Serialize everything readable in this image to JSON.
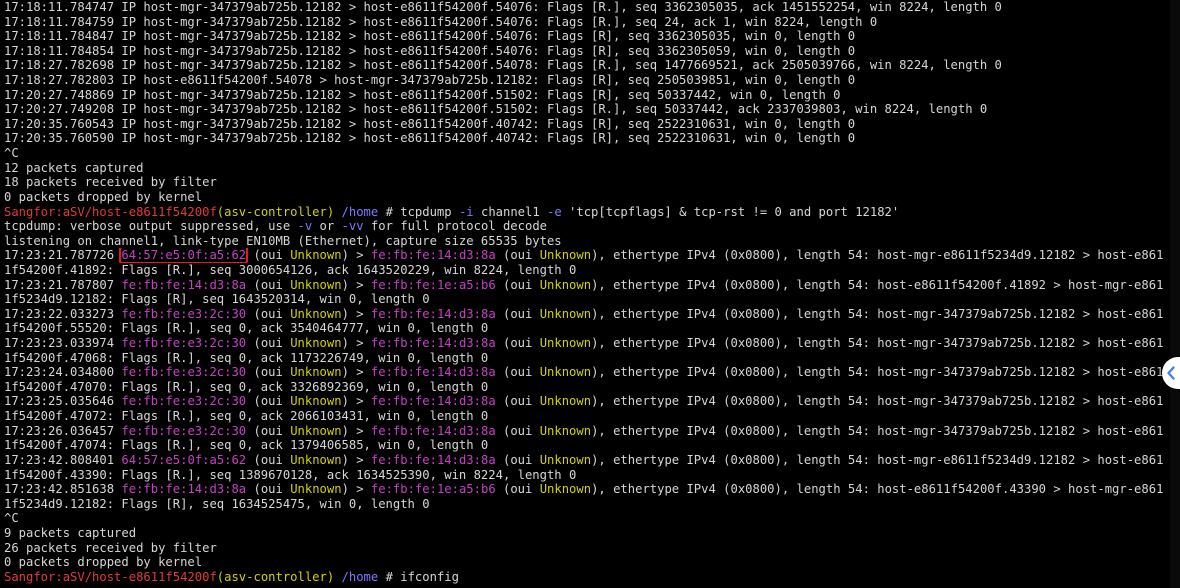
{
  "terminal": {
    "lines": [
      [
        {
          "t": "17:18:11.784747 IP host-mgr-347379ab725b.12182 > host-e8611f54200f.54076: Flags [R.], seq 3362305035, ack 1451552254, win 8224, length 0"
        }
      ],
      [
        {
          "t": "17:18:11.784759 IP host-mgr-347379ab725b.12182 > host-e8611f54200f.54076: Flags [R.], seq 24, ack 1, win 8224, length 0"
        }
      ],
      [
        {
          "t": "17:18:11.784847 IP host-mgr-347379ab725b.12182 > host-e8611f54200f.54076: Flags [R], seq 3362305035, win 0, length 0"
        }
      ],
      [
        {
          "t": "17:18:11.784854 IP host-mgr-347379ab725b.12182 > host-e8611f54200f.54076: Flags [R], seq 3362305059, win 0, length 0"
        }
      ],
      [
        {
          "t": "17:18:27.782698 IP host-mgr-347379ab725b.12182 > host-e8611f54200f.54078: Flags [R.], seq 1477669521, ack 2505039766, win 8224, length 0"
        }
      ],
      [
        {
          "t": "17:18:27.782803 IP host-e8611f54200f.54078 > host-mgr-347379ab725b.12182: Flags [R], seq 2505039851, win 0, length 0"
        }
      ],
      [
        {
          "t": "17:20:27.748869 IP host-mgr-347379ab725b.12182 > host-e8611f54200f.51502: Flags [R], seq 50337442, win 0, length 0"
        }
      ],
      [
        {
          "t": "17:20:27.749208 IP host-mgr-347379ab725b.12182 > host-e8611f54200f.51502: Flags [R.], seq 50337442, ack 2337039803, win 8224, length 0"
        }
      ],
      [
        {
          "t": "17:20:35.760543 IP host-mgr-347379ab725b.12182 > host-e8611f54200f.40742: Flags [R], seq 2522310631, win 0, length 0"
        }
      ],
      [
        {
          "t": "17:20:35.760590 IP host-mgr-347379ab725b.12182 > host-e8611f54200f.40742: Flags [R], seq 2522310631, win 0, length 0"
        }
      ],
      [
        {
          "t": "^C"
        }
      ],
      [
        {
          "t": "12 packets captured"
        }
      ],
      [
        {
          "t": "18 packets received by filter"
        }
      ],
      [
        {
          "t": "0 packets dropped by kernel"
        }
      ],
      [
        {
          "t": "Sangfor:aSV/host-e8611f54200f",
          "c": "red"
        },
        {
          "t": "(asv-controller)",
          "c": "yel"
        },
        {
          "t": " /home",
          "c": "blu"
        },
        {
          "t": " # tcpdump "
        },
        {
          "t": "-i",
          "c": "blu"
        },
        {
          "t": " channel1 "
        },
        {
          "t": "-e",
          "c": "blu"
        },
        {
          "t": " 'tcp[tcpflags] & tcp-rst != 0 and port 12182'"
        }
      ],
      [
        {
          "t": "tcpdump: verbose output suppressed, use "
        },
        {
          "t": "-v",
          "c": "blu"
        },
        {
          "t": " or "
        },
        {
          "t": "-vv",
          "c": "blu"
        },
        {
          "t": " for full protocol decode"
        }
      ],
      [
        {
          "t": "listening on channel1, link-type EN10MB (Ethernet), capture size 65535 bytes"
        }
      ],
      [
        {
          "t": "17:23:21.787726 "
        },
        {
          "t": "64:57:e5:0f:a5:62",
          "c": "mag",
          "hl": true
        },
        {
          "t": " (oui "
        },
        {
          "t": "Unknown",
          "c": "yel"
        },
        {
          "t": ") > "
        },
        {
          "t": "fe:fb:fe:14:d3:8a",
          "c": "mag"
        },
        {
          "t": " (oui "
        },
        {
          "t": "Unknown",
          "c": "yel"
        },
        {
          "t": "), ethertype IPv4 (0x0800), length 54: host-mgr-e8611f5234d9.12182 > host-e861"
        }
      ],
      [
        {
          "t": "1f54200f.41892: Flags [R.], seq 3000654126, ack 1643520229, win 8224, length 0"
        }
      ],
      [
        {
          "t": "17:23:21.787807 "
        },
        {
          "t": "fe:fb:fe:14:d3:8a",
          "c": "mag"
        },
        {
          "t": " (oui "
        },
        {
          "t": "Unknown",
          "c": "yel"
        },
        {
          "t": ") > "
        },
        {
          "t": "fe:fb:fe:1e:a5:b6",
          "c": "mag"
        },
        {
          "t": " (oui "
        },
        {
          "t": "Unknown",
          "c": "yel"
        },
        {
          "t": "), ethertype IPv4 (0x0800), length 54: host-e8611f54200f.41892 > host-mgr-e861"
        }
      ],
      [
        {
          "t": "1f5234d9.12182: Flags [R], seq 1643520314, win 0, length 0"
        }
      ],
      [
        {
          "t": "17:23:22.033273 "
        },
        {
          "t": "fe:fb:fe:e3:2c:30",
          "c": "mag"
        },
        {
          "t": " (oui "
        },
        {
          "t": "Unknown",
          "c": "yel"
        },
        {
          "t": ") > "
        },
        {
          "t": "fe:fb:fe:14:d3:8a",
          "c": "mag"
        },
        {
          "t": " (oui "
        },
        {
          "t": "Unknown",
          "c": "yel"
        },
        {
          "t": "), ethertype IPv4 (0x0800), length 54: host-mgr-347379ab725b.12182 > host-e861"
        }
      ],
      [
        {
          "t": "1f54200f.55520: Flags [R.], seq 0, ack 3540464777, win 0, length 0"
        }
      ],
      [
        {
          "t": "17:23:23.033974 "
        },
        {
          "t": "fe:fb:fe:e3:2c:30",
          "c": "mag"
        },
        {
          "t": " (oui "
        },
        {
          "t": "Unknown",
          "c": "yel"
        },
        {
          "t": ") > "
        },
        {
          "t": "fe:fb:fe:14:d3:8a",
          "c": "mag"
        },
        {
          "t": " (oui "
        },
        {
          "t": "Unknown",
          "c": "yel"
        },
        {
          "t": "), ethertype IPv4 (0x0800), length 54: host-mgr-347379ab725b.12182 > host-e861"
        }
      ],
      [
        {
          "t": "1f54200f.47068: Flags [R.], seq 0, ack 1173226749, win 0, length 0"
        }
      ],
      [
        {
          "t": "17:23:24.034800 "
        },
        {
          "t": "fe:fb:fe:e3:2c:30",
          "c": "mag"
        },
        {
          "t": " (oui "
        },
        {
          "t": "Unknown",
          "c": "yel"
        },
        {
          "t": ") > "
        },
        {
          "t": "fe:fb:fe:14:d3:8a",
          "c": "mag"
        },
        {
          "t": " (oui "
        },
        {
          "t": "Unknown",
          "c": "yel"
        },
        {
          "t": "), ethertype IPv4 (0x0800), length 54: host-mgr-347379ab725b.12182 > host-e861"
        }
      ],
      [
        {
          "t": "1f54200f.47070: Flags [R.], seq 0, ack 3326892369, win 0, length 0"
        }
      ],
      [
        {
          "t": "17:23:25.035646 "
        },
        {
          "t": "fe:fb:fe:e3:2c:30",
          "c": "mag"
        },
        {
          "t": " (oui "
        },
        {
          "t": "Unknown",
          "c": "yel"
        },
        {
          "t": ") > "
        },
        {
          "t": "fe:fb:fe:14:d3:8a",
          "c": "mag"
        },
        {
          "t": " (oui "
        },
        {
          "t": "Unknown",
          "c": "yel"
        },
        {
          "t": "), ethertype IPv4 (0x0800), length 54: host-mgr-347379ab725b.12182 > host-e861"
        }
      ],
      [
        {
          "t": "1f54200f.47072: Flags [R.], seq 0, ack 2066103431, win 0, length 0"
        }
      ],
      [
        {
          "t": "17:23:26.036457 "
        },
        {
          "t": "fe:fb:fe:e3:2c:30",
          "c": "mag"
        },
        {
          "t": " (oui "
        },
        {
          "t": "Unknown",
          "c": "yel"
        },
        {
          "t": ") > "
        },
        {
          "t": "fe:fb:fe:14:d3:8a",
          "c": "mag"
        },
        {
          "t": " (oui "
        },
        {
          "t": "Unknown",
          "c": "yel"
        },
        {
          "t": "), ethertype IPv4 (0x0800), length 54: host-mgr-347379ab725b.12182 > host-e861"
        }
      ],
      [
        {
          "t": "1f54200f.47074: Flags [R.], seq 0, ack 1379406585, win 0, length 0"
        }
      ],
      [
        {
          "t": "17:23:42.808401 "
        },
        {
          "t": "64:57:e5:0f:a5:62",
          "c": "mag"
        },
        {
          "t": " (oui "
        },
        {
          "t": "Unknown",
          "c": "yel"
        },
        {
          "t": ") > "
        },
        {
          "t": "fe:fb:fe:14:d3:8a",
          "c": "mag"
        },
        {
          "t": " (oui "
        },
        {
          "t": "Unknown",
          "c": "yel"
        },
        {
          "t": "), ethertype IPv4 (0x0800), length 54: host-mgr-e8611f5234d9.12182 > host-e861"
        }
      ],
      [
        {
          "t": "1f54200f.43390: Flags [R.], seq 1389670128, ack 1634525390, win 8224, length 0"
        }
      ],
      [
        {
          "t": "17:23:42.851638 "
        },
        {
          "t": "fe:fb:fe:14:d3:8a",
          "c": "mag"
        },
        {
          "t": " (oui "
        },
        {
          "t": "Unknown",
          "c": "yel"
        },
        {
          "t": ") > "
        },
        {
          "t": "fe:fb:fe:1e:a5:b6",
          "c": "mag"
        },
        {
          "t": " (oui "
        },
        {
          "t": "Unknown",
          "c": "yel"
        },
        {
          "t": "), ethertype IPv4 (0x0800), length 54: host-e8611f54200f.43390 > host-mgr-e861"
        }
      ],
      [
        {
          "t": "1f5234d9.12182: Flags [R], seq 1634525475, win 0, length 0"
        }
      ],
      [
        {
          "t": "^C"
        }
      ],
      [
        {
          "t": "9 packets captured"
        }
      ],
      [
        {
          "t": "26 packets received by filter"
        }
      ],
      [
        {
          "t": "0 packets dropped by kernel"
        }
      ],
      [
        {
          "t": "Sangfor:aSV/host-e8611f54200f",
          "c": "red"
        },
        {
          "t": "(asv-controller)",
          "c": "yel"
        },
        {
          "t": " /home",
          "c": "blu"
        },
        {
          "t": " # ifconfig"
        }
      ]
    ]
  },
  "colors": {
    "background": "#000000",
    "text": "#d6d6d6",
    "mac": "#c640c6",
    "unknown": "#d2d200",
    "prompt": "#e23a3a",
    "flag": "#7a7aff",
    "highlight_box": "#e02020"
  },
  "scroll_handle": {
    "icon": "chevron-left-icon",
    "color": "#3b82f6"
  }
}
